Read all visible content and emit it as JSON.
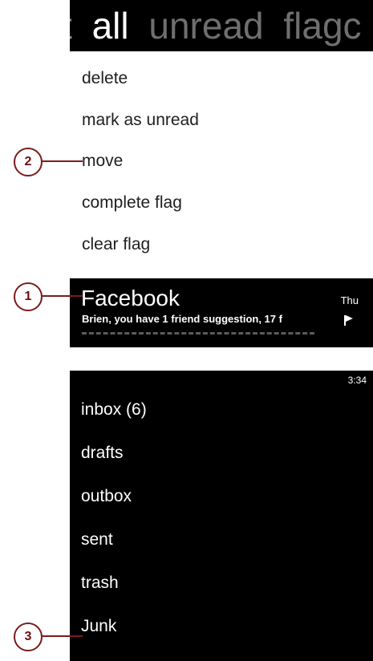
{
  "pivot": {
    "prev_partial": "t",
    "active": "all",
    "next1": "unread",
    "next2": "flagc"
  },
  "context_menu": {
    "items": [
      "delete",
      "mark as unread",
      "move",
      "complete flag",
      "clear flag"
    ]
  },
  "message": {
    "sender": "Facebook",
    "preview": "Brien, you have 1 friend suggestion, 17 f",
    "date": "Thu",
    "flag_icon": "flag-icon"
  },
  "status": {
    "time": "3:34"
  },
  "folders": {
    "items": [
      "inbox (6)",
      "drafts",
      "outbox",
      "sent",
      "trash",
      "Junk"
    ]
  },
  "callouts": {
    "one": "1",
    "two": "2",
    "three": "3"
  },
  "colors": {
    "callout": "#7b1c1c",
    "screen_bg": "#000000",
    "menu_bg": "#ffffff"
  }
}
